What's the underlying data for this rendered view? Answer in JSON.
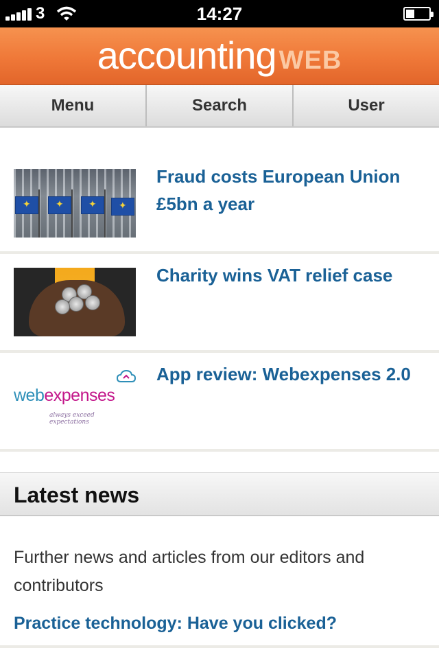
{
  "status_bar": {
    "carrier": "3",
    "time": "14:27",
    "icons": [
      "signal-bars-icon",
      "wifi-icon",
      "battery-icon"
    ],
    "battery_level": 0.3
  },
  "header": {
    "logo_main": "accounting",
    "logo_accent": "WEB",
    "brand_color": "#ef7838"
  },
  "nav": {
    "tabs": [
      {
        "label": "Menu"
      },
      {
        "label": "Search"
      },
      {
        "label": "User"
      }
    ]
  },
  "articles": [
    {
      "headline": "Fraud costs European Union £5bn a year",
      "thumbnail": "eu-flags-image"
    },
    {
      "headline": "Charity wins VAT relief case",
      "thumbnail": "coins-in-hands-image"
    },
    {
      "headline": "App review: Webexpenses 2.0",
      "thumbnail": "webexpenses-logo-image",
      "logo_text_a": "web",
      "logo_text_b": "expenses",
      "logo_tagline": "always exceed expectations"
    }
  ],
  "latest_news": {
    "title": "Latest news",
    "description": "Further news and articles from our editors and contributors",
    "link": "Practice technology: Have you clicked?"
  },
  "colors": {
    "link": "#1a6196",
    "divider": "#ecebe6"
  }
}
